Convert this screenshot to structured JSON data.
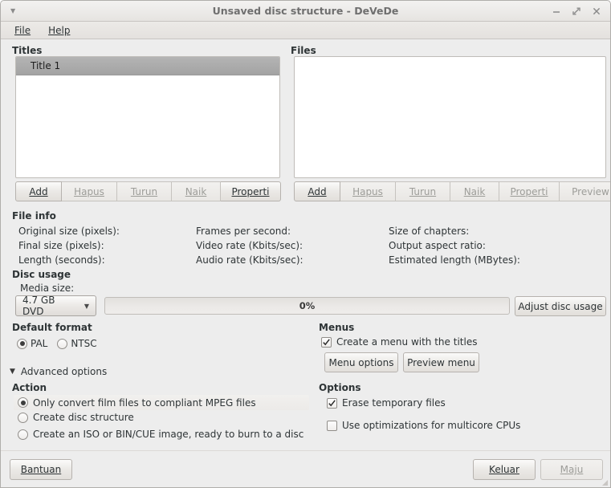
{
  "window": {
    "title": "Unsaved disc structure - DeVeDe",
    "menu_arrow_icon": "chevron-down-icon",
    "controls": {
      "minimize": "minimize-icon",
      "maximize": "maximize-icon",
      "close": "close-icon"
    }
  },
  "menubar": {
    "items": [
      {
        "label": "File",
        "mnemonic": "F"
      },
      {
        "label": "Help",
        "mnemonic": "H"
      }
    ]
  },
  "titles_panel": {
    "heading": "Titles",
    "rows": [
      {
        "label": "Title 1",
        "selected": true
      }
    ],
    "buttons": [
      {
        "label": "Add",
        "mnemonic": "A",
        "enabled": true
      },
      {
        "label": "Hapus",
        "mnemonic": "H",
        "enabled": false
      },
      {
        "label": "Turun",
        "mnemonic": "T",
        "enabled": false
      },
      {
        "label": "Naik",
        "mnemonic": "N",
        "enabled": false
      },
      {
        "label": "Properti",
        "mnemonic": "P",
        "enabled": true
      }
    ]
  },
  "files_panel": {
    "heading": "Files",
    "rows": [],
    "buttons": [
      {
        "label": "Add",
        "mnemonic": "A",
        "enabled": true
      },
      {
        "label": "Hapus",
        "mnemonic": "H",
        "enabled": false
      },
      {
        "label": "Turun",
        "mnemonic": "T",
        "enabled": false
      },
      {
        "label": "Naik",
        "mnemonic": "N",
        "enabled": false
      },
      {
        "label": "Properti",
        "mnemonic": "P",
        "enabled": false
      },
      {
        "label": "Preview",
        "mnemonic": "",
        "enabled": false
      }
    ]
  },
  "file_info": {
    "heading": "File info",
    "column1": [
      "Original size (pixels):",
      "Final size (pixels):",
      "Length (seconds):"
    ],
    "column2": [
      "Frames per second:",
      "Video rate (Kbits/sec):",
      "Audio rate (Kbits/sec):"
    ],
    "column3": [
      "Size of chapters:",
      "Output aspect ratio:",
      "Estimated length (MBytes):"
    ]
  },
  "disc_usage": {
    "heading": "Disc usage",
    "media_size_label": "Media size:",
    "media_size_value": "4.7 GB DVD",
    "media_size_arrow": "chevron-down-icon",
    "progress_text": "0%",
    "progress_percent": 0,
    "adjust_button": "Adjust disc usage"
  },
  "default_format": {
    "heading": "Default format",
    "options": [
      {
        "label": "PAL",
        "selected": true
      },
      {
        "label": "NTSC",
        "selected": false
      }
    ]
  },
  "menus": {
    "heading": "Menus",
    "create_menu_label": "Create a menu with the titles",
    "create_menu_checked": true,
    "buttons": [
      {
        "label": "Menu options"
      },
      {
        "label": "Preview menu"
      }
    ]
  },
  "advanced": {
    "expander_label": "Advanced options",
    "expanded": true,
    "expander_icon": "triangle-down-icon"
  },
  "action": {
    "heading": "Action",
    "options": [
      {
        "label": "Only convert film files to compliant MPEG files",
        "selected": true,
        "highlighted": true
      },
      {
        "label": "Create disc structure",
        "selected": false,
        "highlighted": false
      },
      {
        "label": "Create an ISO or BIN/CUE image, ready to burn to a disc",
        "selected": false,
        "highlighted": false
      }
    ]
  },
  "options": {
    "heading": "Options",
    "items": [
      {
        "label": "Erase temporary files",
        "checked": true
      },
      {
        "label": "Use optimizations for multicore CPUs",
        "checked": false
      }
    ]
  },
  "bottom_bar": {
    "help_button": {
      "label": "Bantuan",
      "mnemonic": "B",
      "enabled": true
    },
    "quit_button": {
      "label": "Keluar",
      "mnemonic": "K",
      "enabled": true
    },
    "forward_button": {
      "label": "Maju",
      "mnemonic": "M",
      "enabled": false
    },
    "resize_grip_icon": "resize-grip-icon"
  },
  "colors": {
    "window_bg": "#ededed",
    "titlebar_top": "#f3f2f1",
    "titlebar_bottom": "#e6e4e1",
    "text": "#2e3436",
    "disabled_text": "#9d9d99",
    "selection_bg": "#a8a8a8",
    "list_bg": "#ffffff",
    "border": "#bfbcb8"
  }
}
